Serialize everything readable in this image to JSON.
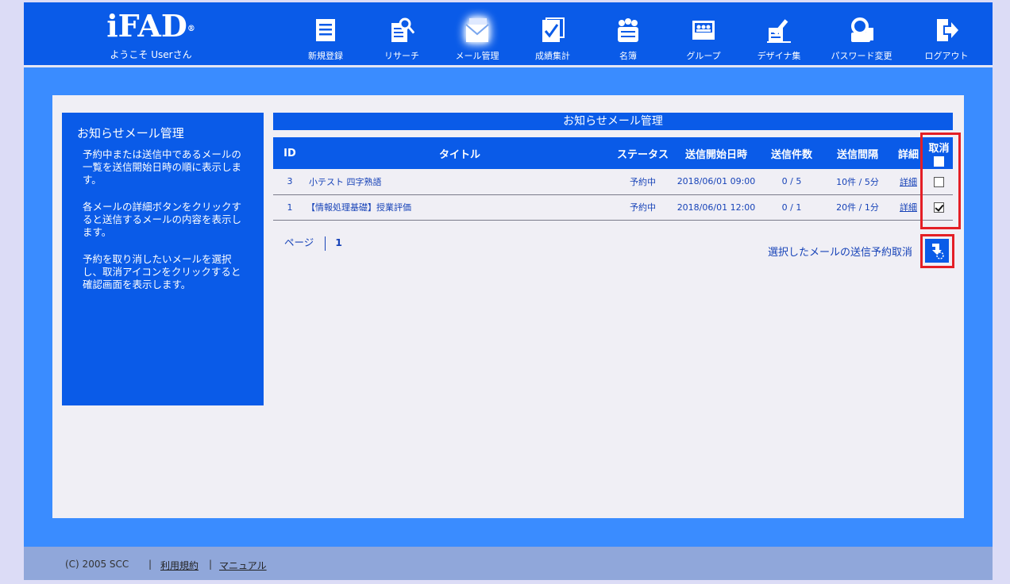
{
  "header": {
    "logo": "iFAD",
    "logo_mark": "®",
    "welcome": "ようこそ Userさん"
  },
  "nav": [
    {
      "label": "新規登録",
      "icon": "new-registration-icon"
    },
    {
      "label": "リサーチ",
      "icon": "research-icon"
    },
    {
      "label": "メール管理",
      "icon": "mail-management-icon",
      "active": true
    },
    {
      "label": "成績集計",
      "icon": "grade-summary-icon"
    },
    {
      "label": "名簿",
      "icon": "roster-icon"
    },
    {
      "label": "グループ",
      "icon": "group-icon"
    },
    {
      "label": "デザイナ集",
      "icon": "designer-icon"
    },
    {
      "label": "パスワード変更",
      "icon": "password-change-icon"
    },
    {
      "label": "ログアウト",
      "icon": "logout-icon"
    }
  ],
  "sidebar": {
    "title": "お知らせメール管理",
    "paragraphs": [
      "予約中または送信中であるメールの一覧を送信開始日時の順に表示します。",
      "各メールの詳細ボタンをクリックすると送信するメールの内容を表示します。",
      "予約を取り消したいメールを選択し、取消アイコンをクリックすると確認画面を表示します。"
    ]
  },
  "main": {
    "title": "お知らせメール管理",
    "columns": {
      "id": "ID",
      "title": "タイトル",
      "status": "ステータス",
      "start": "送信開始日時",
      "count": "送信件数",
      "interval": "送信間隔",
      "detail": "詳細",
      "cancel": "取消"
    },
    "rows": [
      {
        "id": "3",
        "title": "小テスト 四字熟語",
        "status": "予約中",
        "start": "2018/06/01 09:00",
        "count": "0 / 5",
        "interval": "10件 / 5分",
        "detail": "詳細",
        "checked": false
      },
      {
        "id": "1",
        "title": "【情報処理基礎】授業評価",
        "status": "予約中",
        "start": "2018/06/01 12:00",
        "count": "0 / 1",
        "interval": "20件 / 1分",
        "detail": "詳細",
        "checked": true
      }
    ],
    "pager": {
      "label": "ページ",
      "current": "1"
    },
    "cancel_action_label": "選択したメールの送信予約取消"
  },
  "footer": {
    "copyright": "(C) 2005 SCC",
    "sep": "|",
    "terms": "利用規約",
    "manual": "マニュアル"
  },
  "colors": {
    "header_bg": "#0a5be8",
    "band_bg": "#3a8cff",
    "highlight": "#e41f26"
  }
}
